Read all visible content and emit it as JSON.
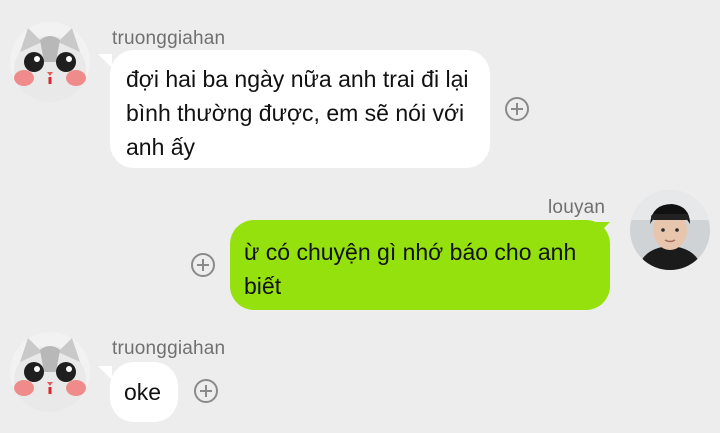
{
  "messages": [
    {
      "direction": "incoming",
      "sender": "truonggiahan",
      "avatar_icon": "cat-avatar-icon",
      "lines": [
        "đợi hai ba ngày nữa anh trai đi lại",
        "bình thường được, em sẽ nói với",
        "anh ấy"
      ]
    },
    {
      "direction": "outgoing",
      "sender": "louyan",
      "avatar_icon": "user-photo-avatar-icon",
      "lines": [
        "ừ có chuyện gì nhớ báo cho anh",
        "biết"
      ]
    },
    {
      "direction": "incoming",
      "sender": "truonggiahan",
      "avatar_icon": "cat-avatar-icon",
      "lines": [
        "oke"
      ]
    }
  ],
  "colors": {
    "background": "#ededed",
    "incoming_bubble": "#ffffff",
    "outgoing_bubble": "#95e10e",
    "sender_text": "#707070",
    "icon_gray": "#8a8a8a"
  },
  "action_icon": "add-circle-icon"
}
